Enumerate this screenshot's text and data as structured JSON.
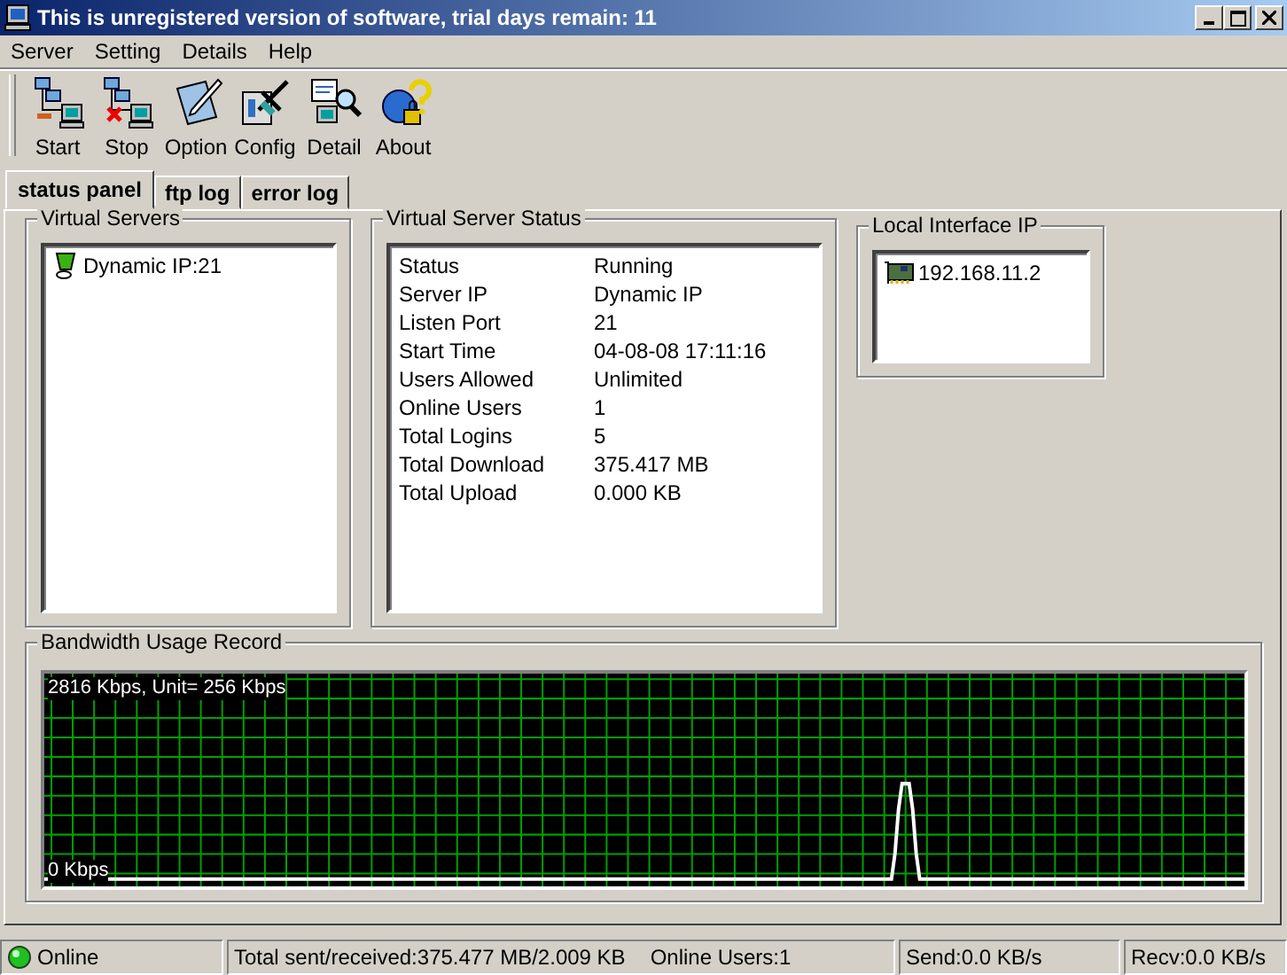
{
  "window": {
    "title": "This is unregistered version of software, trial days remain: 11"
  },
  "menu": [
    "Server",
    "Setting",
    "Details",
    "Help"
  ],
  "toolbar": [
    {
      "label": "Start"
    },
    {
      "label": "Stop"
    },
    {
      "label": "Option"
    },
    {
      "label": "Config"
    },
    {
      "label": "Detail"
    },
    {
      "label": "About"
    }
  ],
  "tabs": [
    {
      "label": "status panel",
      "selected": true
    },
    {
      "label": "ftp log",
      "selected": false
    },
    {
      "label": "error log",
      "selected": false
    }
  ],
  "virtual_servers": {
    "title": "Virtual Servers",
    "items": [
      {
        "label": "Dynamic IP:21"
      }
    ]
  },
  "server_status": {
    "title": "Virtual Server Status",
    "rows": [
      {
        "name": "Status",
        "value": "Running"
      },
      {
        "name": "Server IP",
        "value": "Dynamic IP"
      },
      {
        "name": "Listen Port",
        "value": "21"
      },
      {
        "name": "Start Time",
        "value": "04-08-08 17:11:16"
      },
      {
        "name": "Users Allowed",
        "value": "Unlimited"
      },
      {
        "name": "Online Users",
        "value": "1"
      },
      {
        "name": "Total Logins",
        "value": "5"
      },
      {
        "name": "Total Download",
        "value": "375.417 MB"
      },
      {
        "name": "Total Upload",
        "value": "0.000 KB"
      }
    ]
  },
  "local_interface": {
    "title": "Local Interface IP",
    "items": [
      {
        "label": "192.168.11.2"
      }
    ]
  },
  "bandwidth": {
    "title": "Bandwidth Usage Record",
    "top_label": "2816 Kbps, Unit= 256 Kbps",
    "bottom_label": "0 Kbps"
  },
  "status_bar": {
    "online": {
      "label": "Online",
      "on": true
    },
    "totals": "Total sent/received:375.477 MB/2.009 KB",
    "users": "Online Users:1",
    "send": "Send:0.0 KB/s",
    "recv": "Recv:0.0 KB/s"
  }
}
